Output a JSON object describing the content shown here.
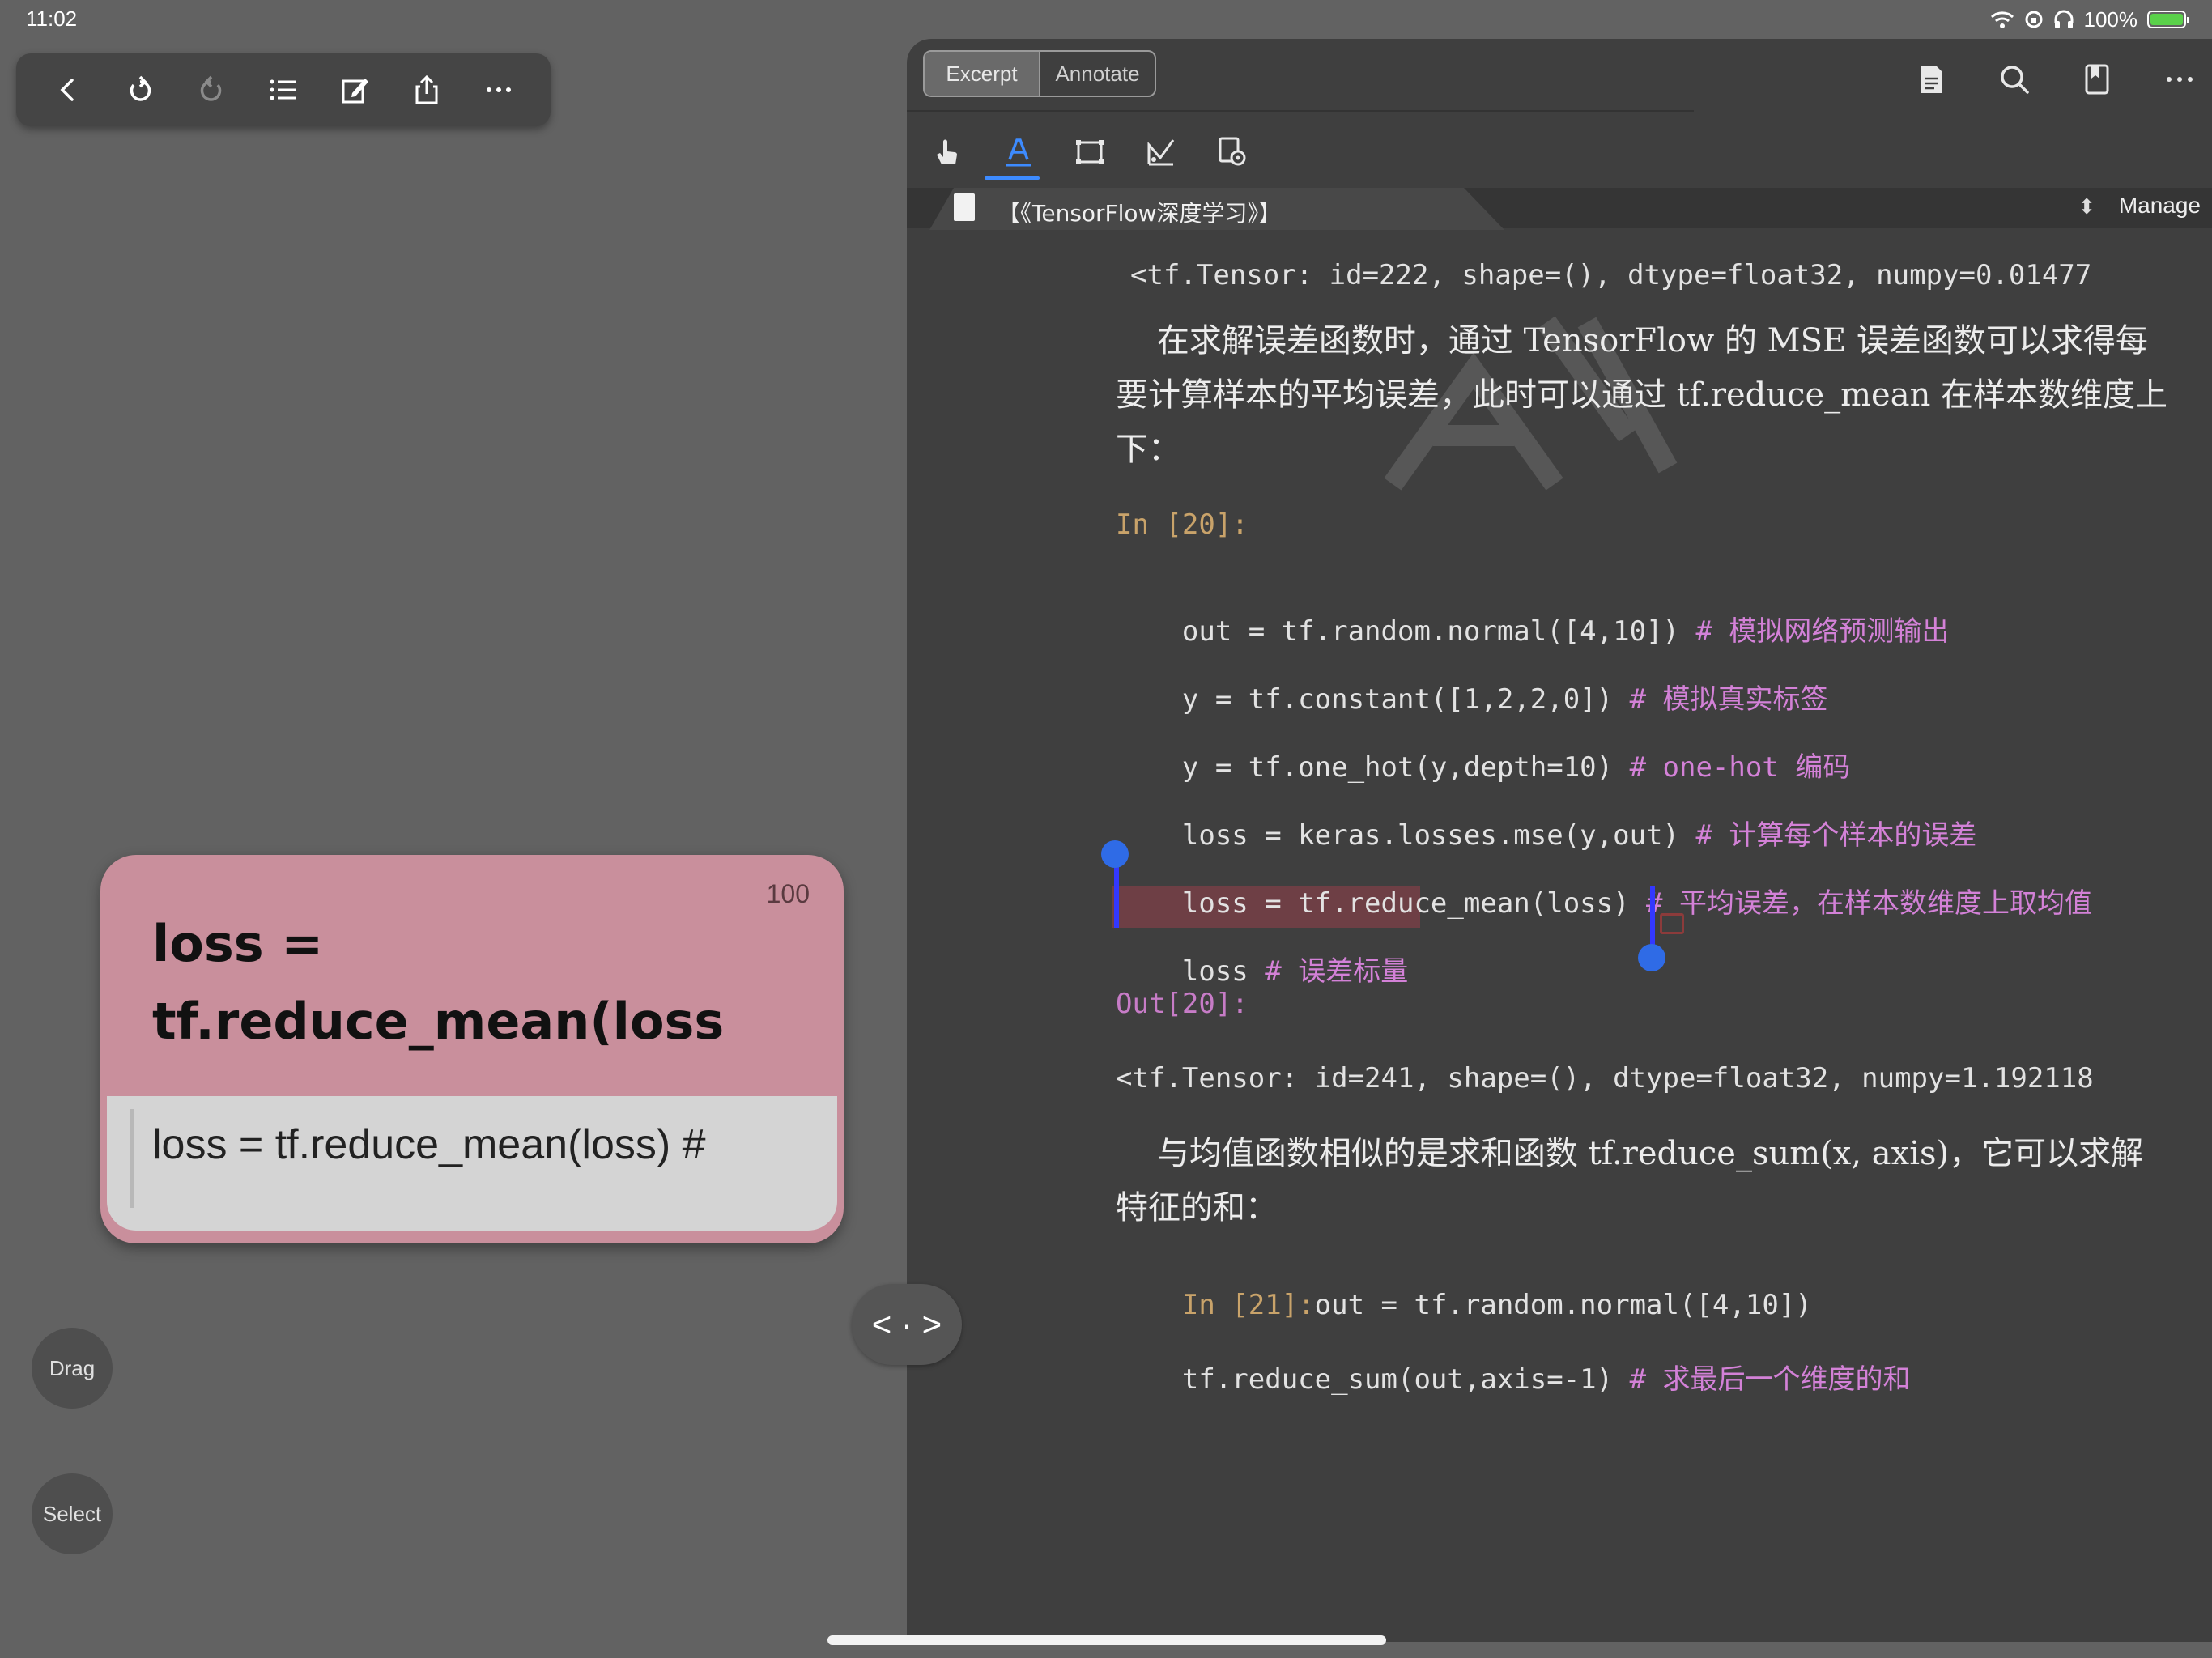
{
  "status_bar": {
    "time": "11:02",
    "battery_text": "100%",
    "battery_level": 1.0
  },
  "left_toolbar": {
    "items": [
      "back-icon",
      "undo-icon",
      "redo-icon",
      "outline-icon",
      "edit-note-icon",
      "share-icon",
      "more-icon"
    ]
  },
  "excerpt_card": {
    "count": "100",
    "title": "loss =\ntf.reduce_mean(loss",
    "body": "loss = tf.reduce_mean(loss) #",
    "color": "#c98f9c"
  },
  "float_buttons": {
    "drag": "Drag",
    "select": "Select"
  },
  "split_handle": {
    "label": "< · >"
  },
  "doc": {
    "segments": {
      "excerpt": "Excerpt",
      "annotate": "Annotate",
      "active": "Excerpt"
    },
    "tools": [
      "hand-tool-icon",
      "text-highlight-icon",
      "rectangle-select-icon",
      "freehand-icon",
      "tool-settings-icon"
    ],
    "active_tool": "text-highlight-icon",
    "actions": [
      "page-icon",
      "search-icon",
      "bookmark-icon",
      "more-icon"
    ],
    "tab_title": "【《TensorFlow深度学习》】",
    "manage": "Manage",
    "accent_color": "#3d8bff",
    "highlight_color": "#6e3f45",
    "lines": {
      "l1": "<tf.Tensor: id=222, shape=(), dtype=float32, numpy=0.01477",
      "p1a": "    在求解误差函数时，通过 TensorFlow 的 MSE 误差函数可以求得每",
      "p1b": "要计算样本的平均误差，此时可以通过 tf.reduce_mean 在样本数维度上",
      "p1c": "下：",
      "in20": "In [20]:",
      "c1_code": "out = tf.random.normal([4,10]) ",
      "c1_cmt": "# 模拟网络预测输出",
      "c2_code": "y = tf.constant([1,2,2,0]) ",
      "c2_cmt": "# 模拟真实标签",
      "c3_code": "y = tf.one_hot(y,depth=10) ",
      "c3_cmt": "# one-hot 编码",
      "c4_code": "loss = keras.losses.mse(y,out) ",
      "c4_cmt": "# 计算每个样本的误差",
      "c5_code": "loss = tf.reduce_mean(loss) ",
      "c5_cmt": "# 平均误差，在样本数维度上取均值",
      "c6_code": "loss ",
      "c6_cmt": "# 误差标量",
      "out20": "Out[20]:",
      "l2": "<tf.Tensor: id=241, shape=(), dtype=float32, numpy=1.192118",
      "p2a": "    与均值函数相似的是求和函数 tf.reduce_sum(x, axis)，它可以求解",
      "p2b": "特征的和：",
      "in21": "In [21]:",
      "c7_code": "out = tf.random.normal([4,10])",
      "c8_code": "tf.reduce_sum(out,axis=-1) ",
      "c8_cmt": "# 求最后一个维度的和"
    }
  }
}
